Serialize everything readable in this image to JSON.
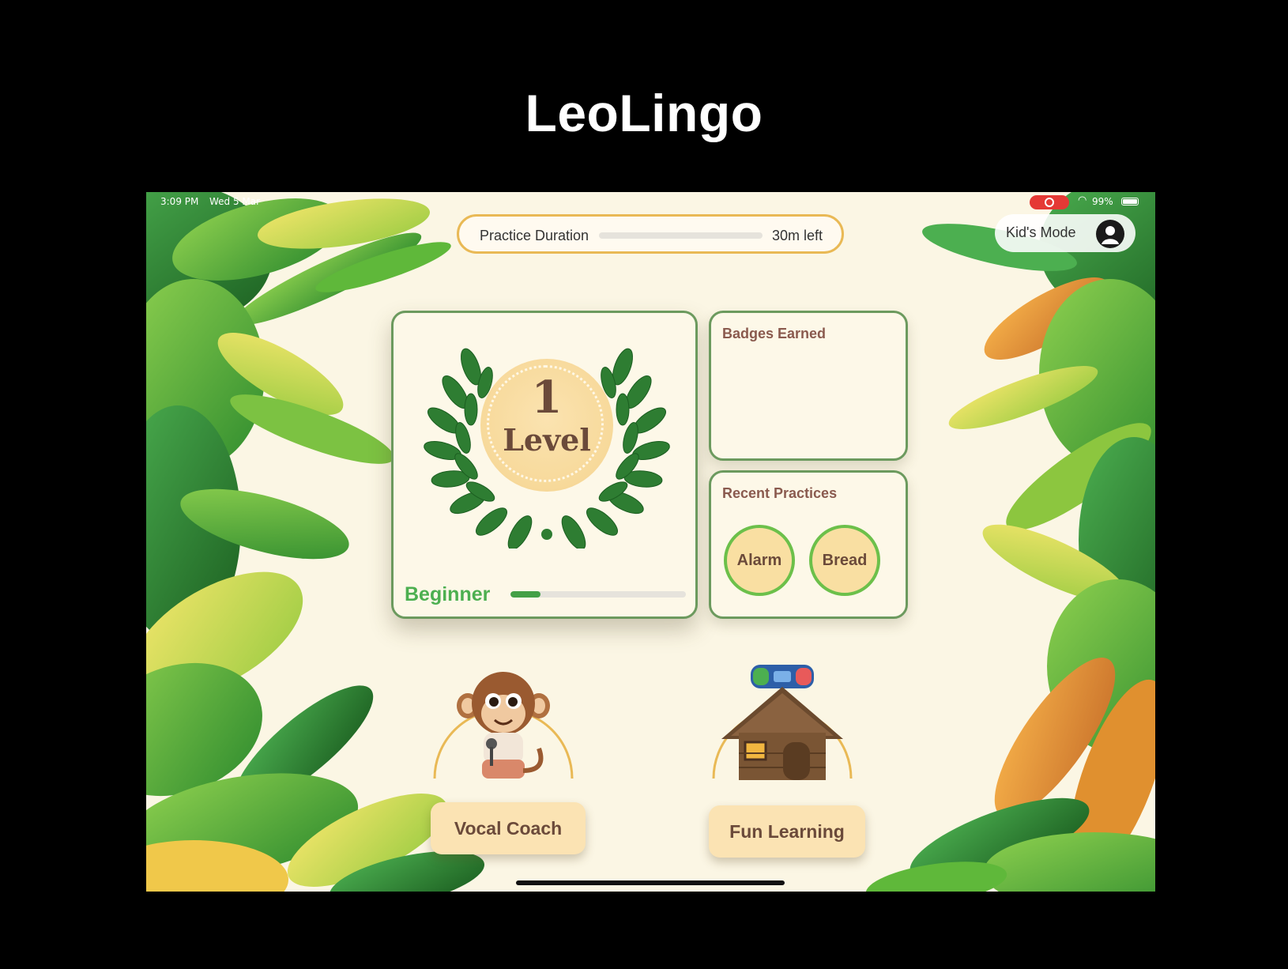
{
  "slide": {
    "title": "LeoLingo"
  },
  "status_bar": {
    "time": "3:09 PM",
    "date": "Wed 5 Mar",
    "battery": "99%",
    "battery_level": 0.99
  },
  "practice": {
    "label": "Practice Duration",
    "remaining": "30m left",
    "progress": 0.0
  },
  "kids_mode": {
    "label": "Kid's Mode",
    "icon": "person-icon"
  },
  "level_card": {
    "level_number": "1",
    "level_word": "Level",
    "rank": "Beginner",
    "rank_progress": 0.17
  },
  "badges": {
    "title": "Badges Earned"
  },
  "recent": {
    "title": "Recent Practices",
    "items": [
      "Alarm",
      "Bread"
    ]
  },
  "features": {
    "vocal_coach": "Vocal Coach",
    "fun_learning": "Fun Learning"
  },
  "colors": {
    "accent_green": "#4caf50",
    "card_border": "#6c9a5e",
    "pill_border": "#e9b955",
    "label_brown": "#6b4a3a"
  }
}
